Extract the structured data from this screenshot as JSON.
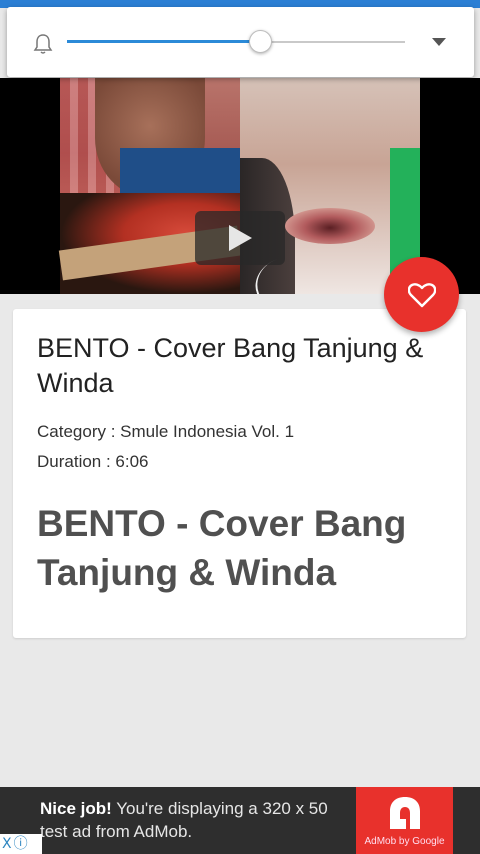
{
  "volume": {
    "level_percent": 57,
    "accent_color": "#2b8ad8",
    "bell_icon": "bell-icon",
    "dropdown_icon": "chevron-down-icon"
  },
  "video": {
    "play_icon": "play-icon"
  },
  "favorite": {
    "icon": "heart-icon",
    "color": "#e8312c"
  },
  "song": {
    "title": "BENTO - Cover Bang Tanjung & Winda",
    "category": "Category : Smule Indonesia Vol. 1",
    "duration": "Duration : 6:06",
    "big_title": "BENTO - Cover Bang Tanjung & Winda"
  },
  "ad": {
    "headline": "Nice job!",
    "body": " You're displaying a 320 x 50 test ad from AdMob.",
    "brand": "AdMob by Google",
    "close_glyph": "X",
    "info_glyph": "ⓘ"
  }
}
